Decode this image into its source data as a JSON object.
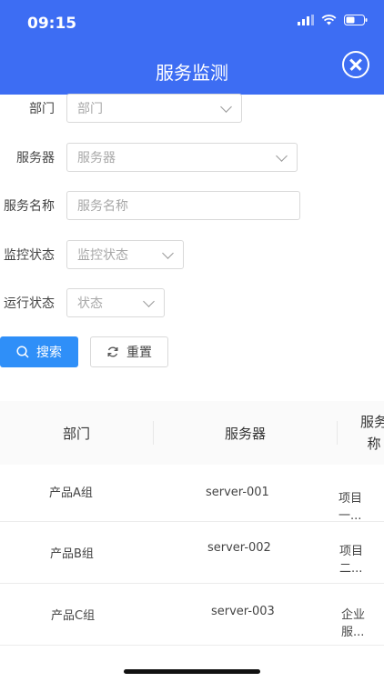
{
  "status_bar": {
    "time": "09:15"
  },
  "header": {
    "title": "服务监测"
  },
  "form": {
    "department": {
      "label": "部门",
      "placeholder": "部门"
    },
    "server": {
      "label": "服务器",
      "placeholder": "服务器"
    },
    "service_name": {
      "label": "服务名称",
      "placeholder": "服务名称"
    },
    "monitor_status": {
      "label": "监控状态",
      "placeholder": "监控状态"
    },
    "run_status": {
      "label": "运行状态",
      "placeholder": "状态"
    }
  },
  "buttons": {
    "search": "搜索",
    "reset": "重置"
  },
  "table": {
    "headers": {
      "department": "部门",
      "server": "服务器",
      "service_name_line1": "服务",
      "service_name_line2": "称"
    },
    "rows": [
      {
        "department": "产品A组",
        "server": "server-001",
        "service": "项目一..."
      },
      {
        "department": "产品B组",
        "server": "server-002",
        "service": "项目二..."
      },
      {
        "department": "产品C组",
        "server": "server-003",
        "service": "企业服..."
      }
    ]
  },
  "colors": {
    "header_bg": "#3d6df3",
    "primary_button": "#2f8ff8"
  }
}
